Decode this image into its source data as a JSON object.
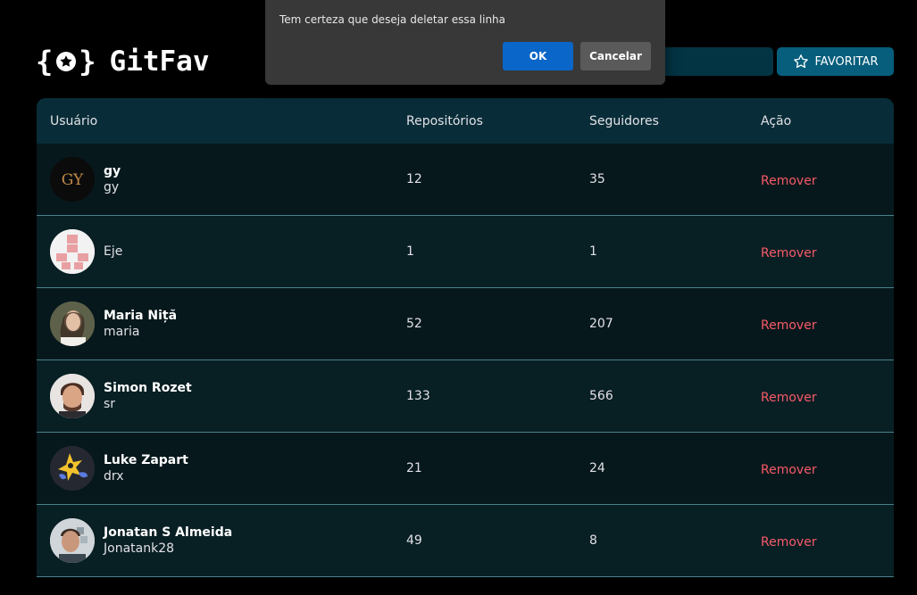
{
  "app": {
    "logo_left_brace": "{",
    "logo_right_brace": "}",
    "title": "GitFav"
  },
  "header": {
    "search_value": "",
    "favorite_label": "FAVORITAR",
    "favorite_icon": "star-outline-icon"
  },
  "table": {
    "columns": [
      "Usuário",
      "Repositórios",
      "Seguidores",
      "Ação"
    ],
    "rows": [
      {
        "name": "gy",
        "login": "gy",
        "repos": "12",
        "followers": "35",
        "action": "Remover",
        "avatar": "logo-gy-avatar"
      },
      {
        "name": "",
        "login": "Eje",
        "repos": "1",
        "followers": "1",
        "action": "Remover",
        "avatar": "identicon-avatar"
      },
      {
        "name": "Maria Niță",
        "login": "maria",
        "repos": "52",
        "followers": "207",
        "action": "Remover",
        "avatar": "photo-avatar"
      },
      {
        "name": "Simon Rozet",
        "login": "sr",
        "repos": "133",
        "followers": "566",
        "action": "Remover",
        "avatar": "photo-avatar"
      },
      {
        "name": "Luke Zapart",
        "login": "drx",
        "repos": "21",
        "followers": "24",
        "action": "Remover",
        "avatar": "cartoon-avatar"
      },
      {
        "name": "Jonatan S Almeida",
        "login": "Jonatank28",
        "repos": "49",
        "followers": "8",
        "action": "Remover",
        "avatar": "photo-avatar"
      }
    ]
  },
  "dialog": {
    "message": "Tem certeza que deseja deletar essa linha",
    "ok_label": "OK",
    "cancel_label": "Cancelar"
  },
  "colors": {
    "background": "#000000",
    "header_row": "#092D38",
    "accent": "#065E7C",
    "remove": "#F75A68",
    "dialog": "#383838",
    "ok_button": "#0A66C8"
  }
}
